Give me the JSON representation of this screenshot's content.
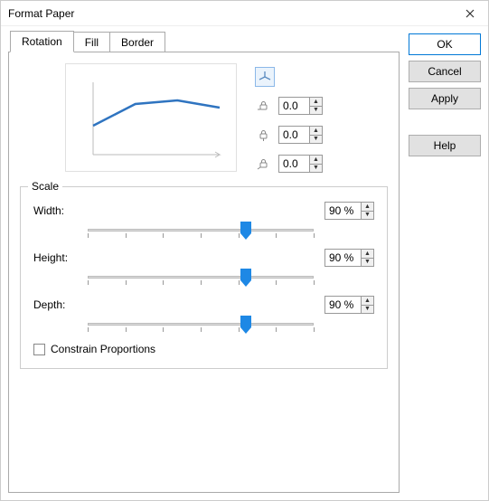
{
  "title": "Format Paper",
  "tabs": {
    "rotation": "Rotation",
    "fill": "Fill",
    "border": "Border"
  },
  "axes": {
    "x": "0.0",
    "y": "0.0",
    "z": "0.0"
  },
  "scale": {
    "legend": "Scale",
    "width_label": "Width:",
    "height_label": "Height:",
    "depth_label": "Depth:",
    "width_value": "90 %",
    "height_value": "90 %",
    "depth_value": "90 %",
    "constrain_label": "Constrain Proportions",
    "constrain_checked": false
  },
  "buttons": {
    "ok": "OK",
    "cancel": "Cancel",
    "apply": "Apply",
    "help": "Help"
  },
  "chart_data": {
    "type": "line",
    "x": [
      0,
      1,
      2,
      3
    ],
    "y": [
      40,
      70,
      75,
      65
    ],
    "ylim": [
      0,
      100
    ],
    "title": "",
    "xlabel": "",
    "ylabel": ""
  }
}
